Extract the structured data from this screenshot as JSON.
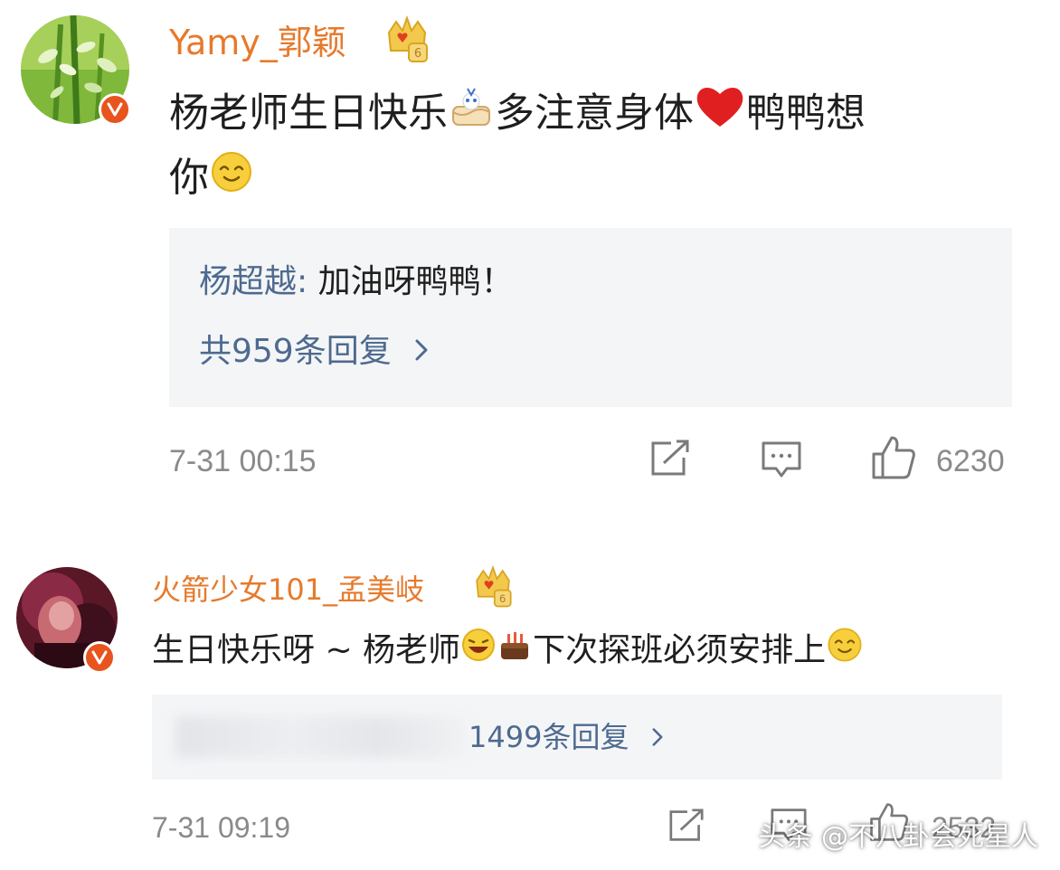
{
  "comments": [
    {
      "username": "Yamy_郭颖",
      "text_a": "杨老师生日快乐",
      "text_b": "多注意身体",
      "text_c": "鸭鸭想",
      "text_d": "你",
      "reply": {
        "user": "杨超越",
        "colon": ": ",
        "text": "加油呀鸭鸭！"
      },
      "reply_count": "共959条回复",
      "timestamp": "7-31 00:15",
      "likes": "6230"
    },
    {
      "username": "火箭少女101_孟美岐",
      "text_a": "生日快乐呀 ~ 杨老师",
      "text_b": "下次探班必须安排上",
      "reply_count": "1499条回复",
      "timestamp": "7-31 09:19",
      "likes": "2532"
    }
  ],
  "watermark": "头条 @不八卦会死星人",
  "icons": {
    "vip": "crown-badge-icon",
    "verified": "verified-v-icon",
    "cake": "cake-emoji-icon",
    "heart": "heart-emoji-icon",
    "smile": "smile-emoji-icon",
    "laugh": "laugh-emoji-icon",
    "share": "share-icon",
    "comment": "comment-icon",
    "like": "thumbs-up-icon",
    "chevron": "chevron-right-icon"
  },
  "colors": {
    "username": "#e67a2c",
    "reply_link": "#4e6a8f",
    "meta": "#8a8a8a",
    "reply_bg": "#f4f5f7",
    "verified": "#e8541e",
    "heart": "#e02020"
  }
}
